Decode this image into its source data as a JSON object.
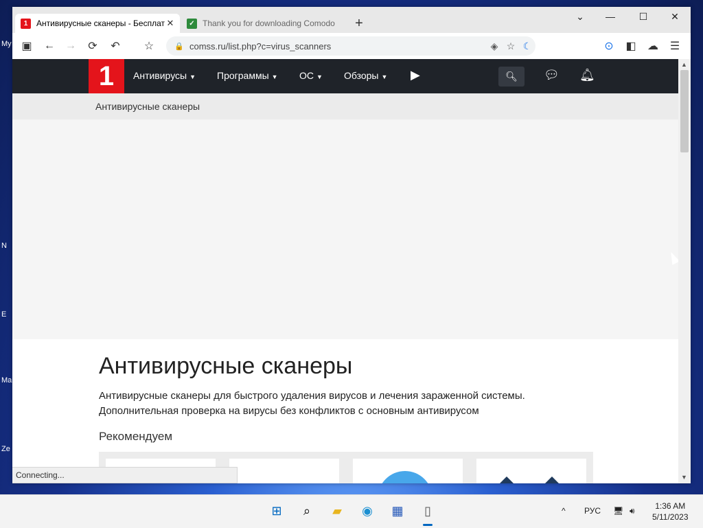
{
  "desktop": {
    "labels": [
      "My",
      "N",
      "E",
      "Ma",
      "Ze"
    ]
  },
  "browser": {
    "tabs": [
      {
        "title": "Антивирусные сканеры - Бесплат",
        "favicon": "1",
        "active": true
      },
      {
        "title": "Thank you for downloading Comodo",
        "favicon": "✓",
        "active": false
      }
    ],
    "url": "comss.ru/list.php?c=virus_scanners",
    "status_text": "Connecting..."
  },
  "site": {
    "logo_text": "1",
    "nav": [
      {
        "label": "Антивирусы"
      },
      {
        "label": "Программы"
      },
      {
        "label": "ОС"
      },
      {
        "label": "Обзоры"
      }
    ],
    "breadcrumb": "Антивирусные сканеры",
    "page_title": "Антивирусные сканеры",
    "lead_line1": "Антивирусные сканеры для быстрого удаления вирусов и лечения зараженной системы.",
    "lead_line2": "Дополнительная проверка на вирусы без конфликтов с основным антивирусом",
    "recommend_heading": "Рекомендуем"
  },
  "taskbar": {
    "language": "РУС",
    "time": "1:36 AM",
    "date": "5/11/2023"
  },
  "colors": {
    "brand_red": "#e4141b",
    "nav_dark": "#1f2329",
    "accent_blue": "#0067c0"
  }
}
